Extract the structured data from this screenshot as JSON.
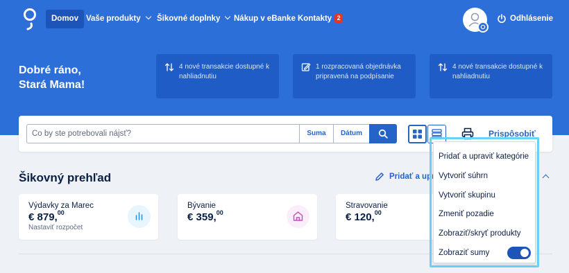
{
  "nav": {
    "items": [
      {
        "label": "Domov",
        "active": true
      },
      {
        "label": "Vaše produkty",
        "has_dropdown": true
      },
      {
        "label": "Šikovné doplnky",
        "has_dropdown": true
      },
      {
        "label": "Nákup v eBanke"
      },
      {
        "label": "Kontakty",
        "badge": "2"
      }
    ],
    "logout_label": "Odhlásenie"
  },
  "hero": {
    "greeting_line1": "Dobré ráno,",
    "greeting_line2": "Stará Mama!",
    "notifications": [
      {
        "icon": "arrows-updown-icon",
        "text": "4 nové transakcie dostupné k nahliadnutiu"
      },
      {
        "icon": "edit-document-icon",
        "text": "1 rozpracovaná objednávka pripravená na podpísanie"
      },
      {
        "icon": "arrows-updown-icon",
        "text": "4 nové transakcie dostupné k nahliadnutiu"
      }
    ]
  },
  "search": {
    "placeholder": "Čo by ste potrebovali nájsť?",
    "value": "",
    "amount_label": "Suma",
    "date_label": "Dátum"
  },
  "toolbar": {
    "customize_label": "Prispôsobiť"
  },
  "overview": {
    "title": "Šikovný prehľad",
    "add_edit_label": "Pridať a upra",
    "cards": [
      {
        "label": "Výdavky za Marec",
        "amount": "€ 879,",
        "cents": "00",
        "sub": "Nastaviť rozpočet",
        "icon": "bar-chart-icon"
      },
      {
        "label": "Bývanie",
        "amount": "€ 359,",
        "cents": "00",
        "sub": "",
        "icon": "house-icon"
      },
      {
        "label": "Stravovanie",
        "amount": "€ 120,",
        "cents": "00",
        "sub": "",
        "icon": "food-icon"
      }
    ]
  },
  "menu": {
    "items": [
      "Pridať a upraviť kategórie",
      "Vytvoriť súhrn",
      "Vytvoriť skupinu",
      "Zmeniť pozadie",
      "Zobraziť/skryť produkty"
    ],
    "toggle_label": "Zobraziť sumy",
    "toggle_on": true
  },
  "colors": {
    "primary": "#2d6fd8",
    "notif_card": "#1f5cc6",
    "accent": "#2563c9",
    "badge": "#e5352b",
    "highlight": "#6ad2f7"
  }
}
